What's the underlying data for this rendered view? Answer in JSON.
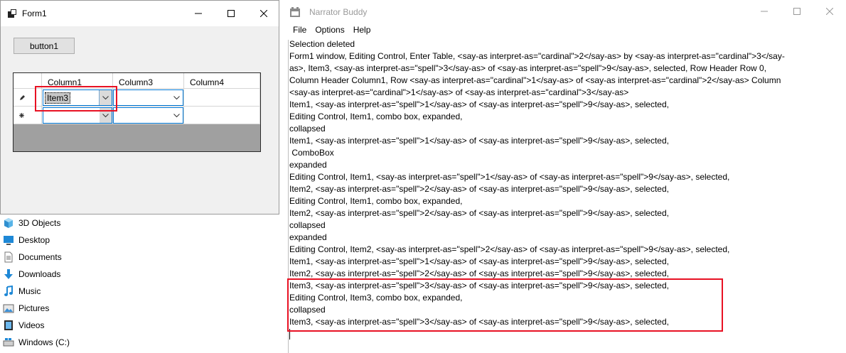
{
  "explorer": {
    "items": [
      {
        "icon": "3d-objects-icon",
        "label": "3D Objects"
      },
      {
        "icon": "desktop-icon",
        "label": "Desktop"
      },
      {
        "icon": "documents-icon",
        "label": "Documents"
      },
      {
        "icon": "downloads-icon",
        "label": "Downloads"
      },
      {
        "icon": "music-icon",
        "label": "Music"
      },
      {
        "icon": "pictures-icon",
        "label": "Pictures"
      },
      {
        "icon": "videos-icon",
        "label": "Videos"
      },
      {
        "icon": "drive-icon",
        "label": "Windows (C:)"
      }
    ]
  },
  "form1": {
    "title": "Form1",
    "button1": "button1",
    "grid": {
      "columns": [
        "Column1",
        "Column3",
        "Column4"
      ],
      "rows": [
        {
          "glyph": "pencil-icon",
          "column1": "Item3",
          "column3": "",
          "column4": ""
        },
        {
          "glyph": "new-row-icon",
          "column1": "",
          "column3": "",
          "column4": ""
        }
      ]
    }
  },
  "narrator": {
    "title": "Narrator Buddy",
    "menu": [
      "File",
      "Options",
      "Help"
    ],
    "log": [
      "Selection deleted",
      "Form1 window, Editing Control, Enter Table, <say-as interpret-as=\"cardinal\">2</say-as> by <say-as interpret-as=\"cardinal\">3</say-",
      "as>, Item3, <say-as interpret-as=\"spell\">3</say-as> of <say-as interpret-as=\"spell\">9</say-as>, selected, Row Header Row 0,",
      "Column Header Column1, Row <say-as interpret-as=\"cardinal\">1</say-as> of <say-as interpret-as=\"cardinal\">2</say-as> Column",
      "<say-as interpret-as=\"cardinal\">1</say-as> of <say-as interpret-as=\"cardinal\">3</say-as>",
      "Item1, <say-as interpret-as=\"spell\">1</say-as> of <say-as interpret-as=\"spell\">9</say-as>, selected,",
      "Editing Control, Item1, combo box, expanded,",
      "collapsed",
      "Item1, <say-as interpret-as=\"spell\">1</say-as> of <say-as interpret-as=\"spell\">9</say-as>, selected,",
      " ComboBox",
      "expanded",
      "Editing Control, Item1, <say-as interpret-as=\"spell\">1</say-as> of <say-as interpret-as=\"spell\">9</say-as>, selected,",
      "Item2, <say-as interpret-as=\"spell\">2</say-as> of <say-as interpret-as=\"spell\">9</say-as>, selected,",
      "Editing Control, Item1, combo box, expanded,",
      "Item2, <say-as interpret-as=\"spell\">2</say-as> of <say-as interpret-as=\"spell\">9</say-as>, selected,",
      "collapsed",
      "expanded",
      "Editing Control, Item2, <say-as interpret-as=\"spell\">2</say-as> of <say-as interpret-as=\"spell\">9</say-as>, selected,",
      "Item1, <say-as interpret-as=\"spell\">1</say-as> of <say-as interpret-as=\"spell\">9</say-as>, selected,",
      "Item2, <say-as interpret-as=\"spell\">2</say-as> of <say-as interpret-as=\"spell\">9</say-as>, selected,",
      "Item3, <say-as interpret-as=\"spell\">3</say-as> of <say-as interpret-as=\"spell\">9</say-as>, selected,",
      "Editing Control, Item3, combo box, expanded,",
      "collapsed",
      "Item3, <say-as interpret-as=\"spell\">3</say-as> of <say-as interpret-as=\"spell\">9</say-as>, selected,"
    ]
  },
  "colors": {
    "highlight_red": "#e81123",
    "focus_blue": "#0078d7"
  }
}
